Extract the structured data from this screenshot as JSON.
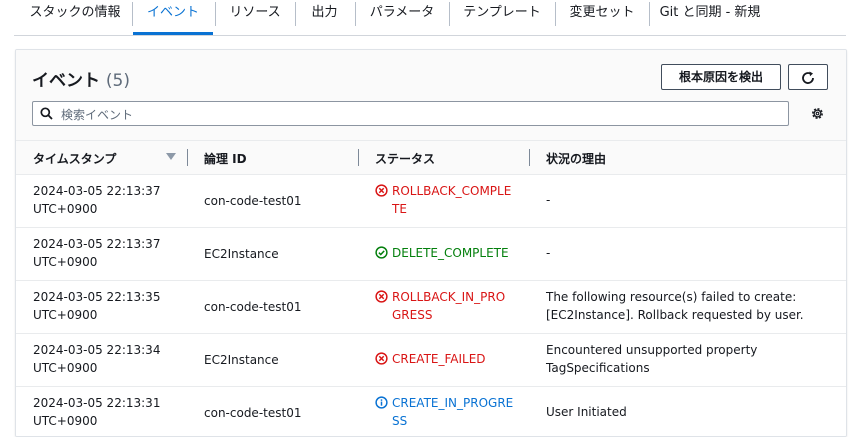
{
  "tabs": [
    {
      "label": "スタックの情報"
    },
    {
      "label": "イベント"
    },
    {
      "label": "リソース"
    },
    {
      "label": "出力"
    },
    {
      "label": "パラメータ"
    },
    {
      "label": "テンプレート"
    },
    {
      "label": "変更セット"
    },
    {
      "label": "Git と同期 - 新規"
    }
  ],
  "active_tab": "イベント",
  "panel": {
    "title": "イベント",
    "count": "(5)",
    "root_cause_button": "根本原因を検出",
    "search_placeholder": "検索イベント"
  },
  "table": {
    "columns": [
      "タイムスタンプ",
      "論理 ID",
      "ステータス",
      "状況の理由"
    ],
    "rows": [
      {
        "time1": "2024-03-05 22:13:37",
        "time2": "UTC+0900",
        "logical_id": "con-code-test01",
        "status": "ROLLBACK_COMPLETE",
        "status_kind": "error",
        "reason": "-"
      },
      {
        "time1": "2024-03-05 22:13:37",
        "time2": "UTC+0900",
        "logical_id": "EC2Instance",
        "status": "DELETE_COMPLETE",
        "status_kind": "success",
        "reason": "-"
      },
      {
        "time1": "2024-03-05 22:13:35",
        "time2": "UTC+0900",
        "logical_id": "con-code-test01",
        "status": "ROLLBACK_IN_PROGRESS",
        "status_kind": "error",
        "reason": "The following resource(s) failed to create: [EC2Instance]. Rollback requested by user."
      },
      {
        "time1": "2024-03-05 22:13:34",
        "time2": "UTC+0900",
        "logical_id": "EC2Instance",
        "status": "CREATE_FAILED",
        "status_kind": "error",
        "reason": "Encountered unsupported property TagSpecifications"
      },
      {
        "time1": "2024-03-05 22:13:31",
        "time2": "UTC+0900",
        "logical_id": "con-code-test01",
        "status": "CREATE_IN_PROGRESS",
        "status_kind": "info",
        "reason": "User Initiated"
      }
    ]
  },
  "colors": {
    "accent": "#0972d3",
    "error": "#d91515",
    "success": "#037f0c",
    "info": "#0972d3"
  }
}
